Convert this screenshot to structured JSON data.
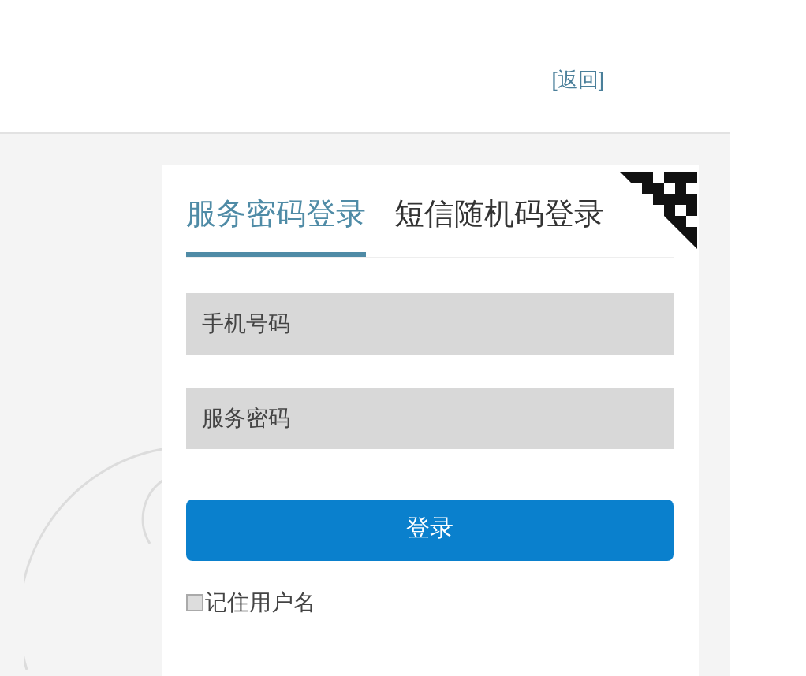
{
  "header": {
    "back_link": "[返回]"
  },
  "tabs": [
    {
      "label": "服务密码登录",
      "selected": true
    },
    {
      "label": "短信随机码登录",
      "selected": false
    }
  ],
  "fields": [
    {
      "placeholder": "手机号码"
    },
    {
      "placeholder": "服务密码"
    }
  ],
  "login_button": "登录",
  "remember": {
    "label": "记住用户名",
    "checked": false
  }
}
